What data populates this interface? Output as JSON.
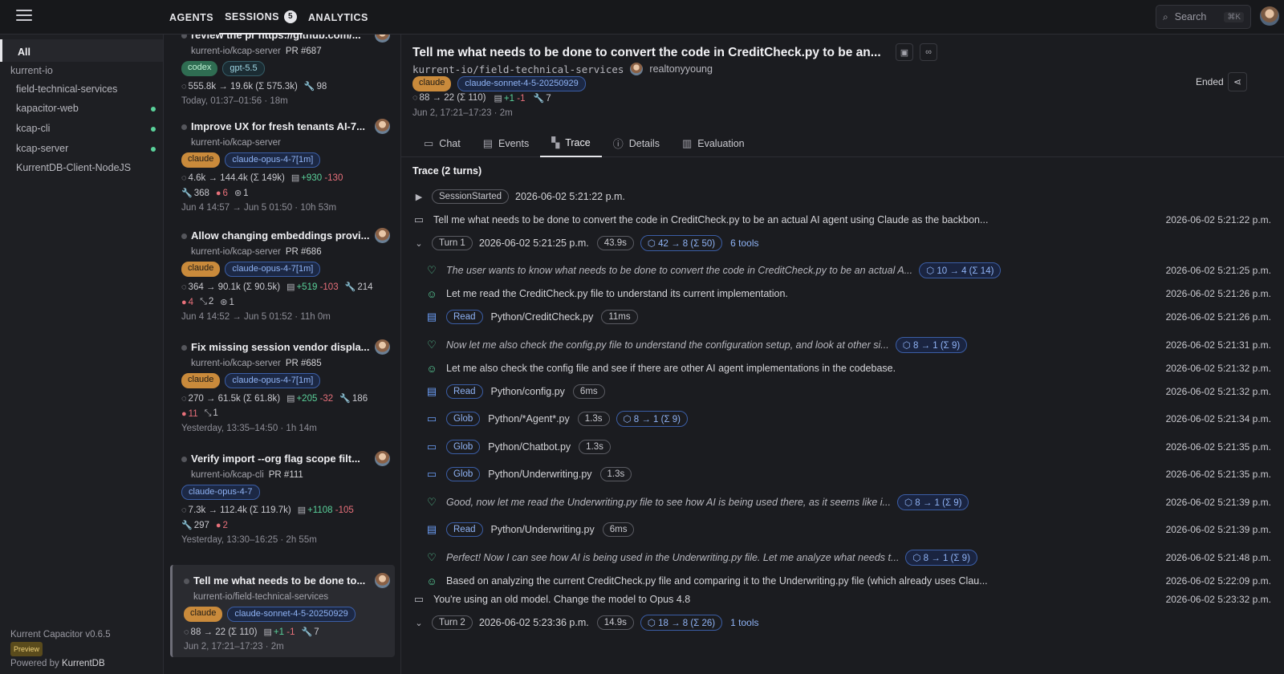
{
  "topnav": {
    "tabs": [
      "AGENTS",
      "SESSIONS",
      "ANALYTICS"
    ],
    "sessions_count": "5",
    "search_label": "Search",
    "search_shortcut": "⌘K"
  },
  "sidebar": {
    "all_label": "All",
    "group": "kurrent-io",
    "items": [
      "field-technical-services",
      "kapacitor-web",
      "kcap-cli",
      "kcap-server",
      "KurrentDB-Client-NodeJS"
    ],
    "version": "Kurrent Capacitor v0.6.5",
    "preview": "Preview",
    "powered_by": "Powered by",
    "powered_brand": "KurrentDB"
  },
  "sessions": [
    {
      "title": "review the pr https://github.com/...",
      "repo": "kurrent-io/kcap-server",
      "pr": "PR #687",
      "tags": [
        "codex",
        "gpt-5.5"
      ],
      "tokens": "555.8k → 19.6k (Σ 575.3k)",
      "tools": "98",
      "time": "Today, 01:37–01:56 · 18m"
    },
    {
      "title": "Improve UX for fresh tenants AI-7...",
      "repo": "kurrent-io/kcap-server",
      "tags": [
        "claude",
        "claude-opus-4-7[1m]"
      ],
      "tokens": "4.6k → 144.4k (Σ 149k)",
      "plus": "+930",
      "minus": "-130",
      "tools": "368",
      "errors": "6",
      "agents": "1",
      "time": "Jun 4 14:57 → Jun 5 01:50 · 10h 53m"
    },
    {
      "title": "Allow changing embeddings provi...",
      "repo": "kurrent-io/kcap-server",
      "pr": "PR #686",
      "tags": [
        "claude",
        "claude-opus-4-7[1m]"
      ],
      "tokens": "364 → 90.1k (Σ 90.5k)",
      "plus": "+519",
      "minus": "-103",
      "tools": "214",
      "errors": "4",
      "compacts": "2",
      "agents": "1",
      "time": "Jun 4 14:52 → Jun 5 01:52 · 11h 0m"
    },
    {
      "title": "Fix missing session vendor displa...",
      "repo": "kurrent-io/kcap-server",
      "pr": "PR #685",
      "tags": [
        "claude",
        "claude-opus-4-7[1m]"
      ],
      "tokens": "270 → 61.5k (Σ 61.8k)",
      "plus": "+205",
      "minus": "-32",
      "tools": "186",
      "errors": "11",
      "compacts": "1",
      "time": "Yesterday, 13:35–14:50 · 1h 14m"
    },
    {
      "title": "Verify import --org flag scope filt...",
      "repo": "kurrent-io/kcap-cli",
      "pr": "PR #111",
      "tags": [
        "claude-opus-4-7"
      ],
      "tokens": "7.3k → 112.4k (Σ 119.7k)",
      "plus": "+1108",
      "minus": "-105",
      "tools": "297",
      "errors": "2",
      "time": "Yesterday, 13:30–16:25 · 2h 55m"
    },
    {
      "title": "Tell me what needs to be done to...",
      "repo": "kurrent-io/field-technical-services",
      "tags": [
        "claude",
        "claude-sonnet-4-5-20250929"
      ],
      "tokens": "88 → 22 (Σ 110)",
      "plus": "+1",
      "minus": "-1",
      "tools": "7",
      "time": "Jun 2, 17:21–17:23 · 2m"
    }
  ],
  "detail": {
    "title": "Tell me what needs to be done to convert the code in CreditCheck.py to be an...",
    "repo": "kurrent-io/field-technical-services",
    "user": "realtonyyoung",
    "tags": [
      "claude",
      "claude-sonnet-4-5-20250929"
    ],
    "tokens": "88 → 22 (Σ 110)",
    "plus": "+1",
    "minus": "-1",
    "tools": "7",
    "time": "Jun 2, 17:21–17:23 · 2m",
    "status": "Ended",
    "tabs": [
      "Chat",
      "Events",
      "Trace",
      "Details",
      "Evaluation"
    ],
    "trace_title": "Trace (2 turns)"
  },
  "trace": {
    "session_started": {
      "label": "SessionStarted",
      "ts": "2026-06-02 5:21:22 p.m."
    },
    "prompt1": {
      "text": "Tell me what needs to be done to convert the code in CreditCheck.py to be an actual AI agent using Claude as the backbon...",
      "ts": "2026-06-02 5:21:22 p.m."
    },
    "turn1": {
      "label": "Turn 1",
      "start": "2026-06-02 5:21:25 p.m.",
      "dur": "43.9s",
      "tokens": "42 → 8 (Σ 50)",
      "tools": "6 tools"
    },
    "steps": [
      {
        "kind": "thinking",
        "text": "The user wants to know what needs to be done to convert the code in CreditCheck.py to be an actual A...",
        "tokens": "10 → 4 (Σ 14)",
        "ts": "2026-06-02 5:21:25 p.m."
      },
      {
        "kind": "assistant",
        "text": "Let me read the CreditCheck.py file to understand its current implementation.",
        "ts": "2026-06-02 5:21:26 p.m."
      },
      {
        "kind": "tool",
        "tool": "Read",
        "path": "Python/CreditCheck.py",
        "dur": "11ms",
        "ts": "2026-06-02 5:21:26 p.m."
      },
      {
        "kind": "thinking",
        "text": "Now let me also check the config.py file to understand the configuration setup, and look at other si...",
        "tokens": "8 → 1 (Σ 9)",
        "ts": "2026-06-02 5:21:31 p.m."
      },
      {
        "kind": "assistant",
        "text": "Let me also check the config file and see if there are other AI agent implementations in the codebase.",
        "ts": "2026-06-02 5:21:32 p.m."
      },
      {
        "kind": "tool",
        "tool": "Read",
        "path": "Python/config.py",
        "dur": "6ms",
        "ts": "2026-06-02 5:21:32 p.m."
      },
      {
        "kind": "glob",
        "tool": "Glob",
        "path": "Python/*Agent*.py",
        "dur": "1.3s",
        "tokens": "8 → 1 (Σ 9)",
        "ts": "2026-06-02 5:21:34 p.m."
      },
      {
        "kind": "glob",
        "tool": "Glob",
        "path": "Python/Chatbot.py",
        "dur": "1.3s",
        "ts": "2026-06-02 5:21:35 p.m."
      },
      {
        "kind": "glob",
        "tool": "Glob",
        "path": "Python/Underwriting.py",
        "dur": "1.3s",
        "ts": "2026-06-02 5:21:35 p.m."
      },
      {
        "kind": "thinking",
        "text": "Good, now let me read the Underwriting.py file to see how AI is being used there, as it seems like i...",
        "tokens": "8 → 1 (Σ 9)",
        "ts": "2026-06-02 5:21:39 p.m."
      },
      {
        "kind": "tool",
        "tool": "Read",
        "path": "Python/Underwriting.py",
        "dur": "6ms",
        "ts": "2026-06-02 5:21:39 p.m."
      },
      {
        "kind": "thinking",
        "text": "Perfect! Now I can see how AI is being used in the Underwriting.py file. Let me analyze what needs t...",
        "tokens": "8 → 1 (Σ 9)",
        "ts": "2026-06-02 5:21:48 p.m."
      },
      {
        "kind": "assistant",
        "text": "Based on analyzing the current CreditCheck.py file and comparing it to the Underwriting.py file (which already uses Clau...",
        "ts": "2026-06-02 5:22:09 p.m."
      }
    ],
    "prompt2": {
      "text": "You're using an old model. Change the model to Opus 4.8",
      "ts": "2026-06-02 5:23:32 p.m."
    },
    "turn2": {
      "label": "Turn 2",
      "start": "2026-06-02 5:23:36 p.m.",
      "dur": "14.9s",
      "tokens": "18 → 8 (Σ 26)",
      "tools": "1 tools"
    }
  }
}
